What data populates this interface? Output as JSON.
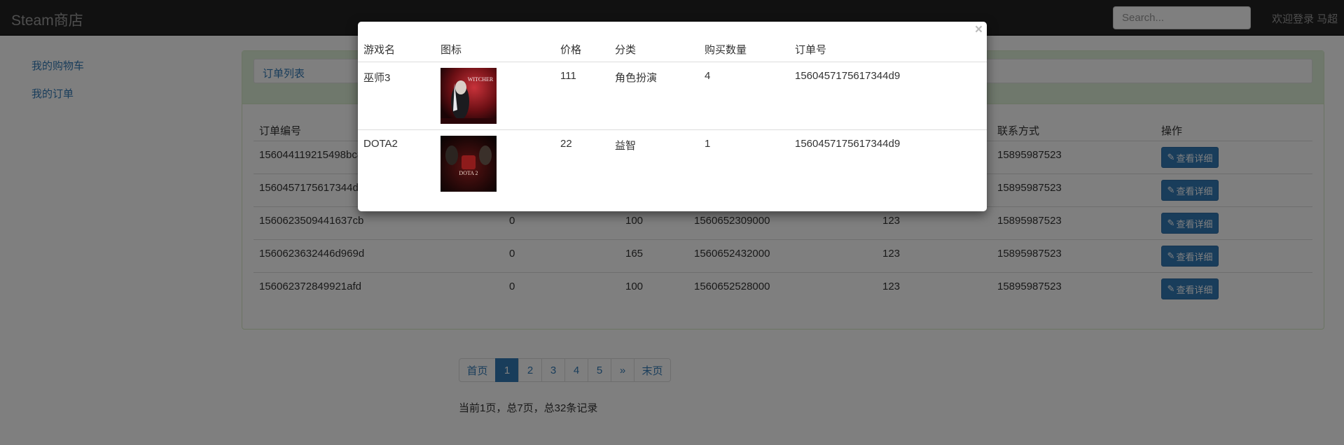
{
  "navbar": {
    "brand": "Steam商店",
    "search_placeholder": "Search...",
    "welcome": "欢迎登录 马超"
  },
  "sidebar": {
    "items": [
      {
        "label": "我的购物车"
      },
      {
        "label": "我的订单"
      }
    ]
  },
  "panel": {
    "title": "订单列表",
    "columns": [
      "订单编号",
      "联系方式",
      "操作"
    ],
    "rows": [
      {
        "order_id": "156044119215498bc8",
        "c2": "",
        "c3": "",
        "c4": "",
        "c5": "",
        "phone": "15895987523",
        "action": "查看详细"
      },
      {
        "order_id": "1560457175617344d9",
        "c2": "",
        "c3": "",
        "c4": "",
        "c5": "",
        "phone": "15895987523",
        "action": "查看详细"
      },
      {
        "order_id": "1560623509441637cb",
        "c2": "0",
        "c3": "100",
        "c4": "1560652309000",
        "c5": "123",
        "phone": "15895987523",
        "action": "查看详细"
      },
      {
        "order_id": "1560623632446d969d",
        "c2": "0",
        "c3": "165",
        "c4": "1560652432000",
        "c5": "123",
        "phone": "15895987523",
        "action": "查看详细"
      },
      {
        "order_id": "156062372849921afd",
        "c2": "0",
        "c3": "100",
        "c4": "1560652528000",
        "c5": "123",
        "phone": "15895987523",
        "action": "查看详细"
      }
    ]
  },
  "pagination": {
    "first": "首页",
    "pages": [
      "1",
      "2",
      "3",
      "4",
      "5"
    ],
    "next": "»",
    "last": "末页",
    "current": "1",
    "summary": "当前1页，总7页，总32条记录"
  },
  "modal": {
    "close": "×",
    "columns": [
      "游戏名",
      "图标",
      "价格",
      "分类",
      "购买数量",
      "订单号"
    ],
    "rows": [
      {
        "name": "巫师3",
        "icon": "witcher-3-cover",
        "price": "111",
        "category": "角色扮演",
        "quantity": "4",
        "order_no": "1560457175617344d9",
        "thumb_text": "WITCHER"
      },
      {
        "name": "DOTA2",
        "icon": "dota-2-cover",
        "price": "22",
        "category": "益智",
        "quantity": "1",
        "order_no": "1560457175617344d9",
        "thumb_text": "DOTA 2"
      }
    ]
  },
  "colors": {
    "primary": "#337ab7",
    "navbar": "#222222",
    "panel_header": "#dff0d8"
  }
}
